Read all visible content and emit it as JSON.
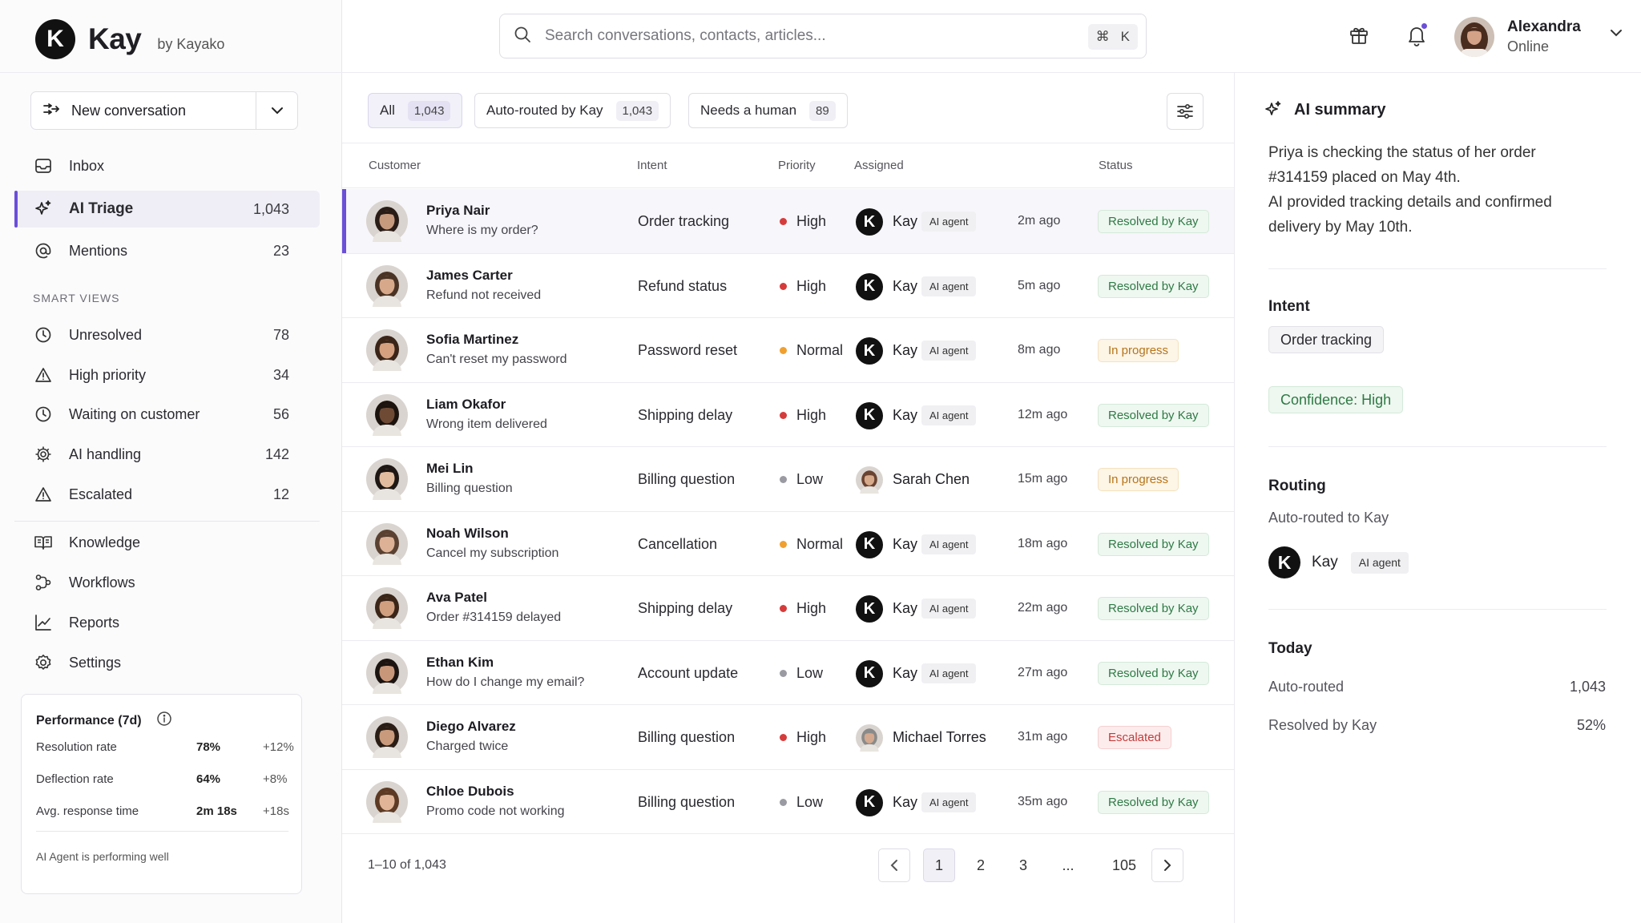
{
  "brand": {
    "logo_letter": "K",
    "name": "Kay",
    "by": "by Kayako"
  },
  "search": {
    "placeholder": "Search conversations, contacts, articles...",
    "shortcut_mod": "⌘",
    "shortcut_key": "K"
  },
  "user": {
    "name": "Alexandra",
    "status": "Online"
  },
  "sidebar": {
    "new_conversation": "New conversation",
    "primary": [
      {
        "label": "Inbox",
        "count": "",
        "icon": "inbox-icon"
      },
      {
        "label": "AI Triage",
        "count": "1,043",
        "icon": "sparkle-icon",
        "active": true
      },
      {
        "label": "Mentions",
        "count": "23",
        "icon": "at-icon"
      }
    ],
    "smart_views_label": "SMART VIEWS",
    "smart_views": [
      {
        "label": "Unresolved",
        "count": "78",
        "icon": "clock-icon"
      },
      {
        "label": "High priority",
        "count": "34",
        "icon": "warning-icon"
      },
      {
        "label": "Waiting on customer",
        "count": "56",
        "icon": "clock-icon"
      },
      {
        "label": "AI handling",
        "count": "142",
        "icon": "gear-icon"
      },
      {
        "label": "Escalated",
        "count": "12",
        "icon": "warning-icon"
      }
    ],
    "tools": [
      {
        "label": "Knowledge",
        "icon": "book-icon"
      },
      {
        "label": "Workflows",
        "icon": "workflow-icon"
      },
      {
        "label": "Reports",
        "icon": "chart-icon"
      },
      {
        "label": "Settings",
        "icon": "settings-icon"
      }
    ],
    "performance": {
      "title": "Performance (7d)",
      "rows": [
        {
          "label": "Resolution rate",
          "value": "78%",
          "delta": "+12%"
        },
        {
          "label": "Deflection rate",
          "value": "64%",
          "delta": "+8%"
        },
        {
          "label": "Avg. response time",
          "value": "2m 18s",
          "delta": "+18s"
        }
      ],
      "note": "AI Agent is performing well"
    }
  },
  "filters": [
    {
      "label": "All",
      "count": "1,043",
      "active": true
    },
    {
      "label": "Auto-routed by Kay",
      "count": "1,043"
    },
    {
      "label": "Needs a human",
      "count": "89"
    }
  ],
  "table": {
    "columns": {
      "customer": "Customer",
      "intent": "Intent",
      "priority": "Priority",
      "assigned": "Assigned",
      "status": "Status"
    },
    "rows": [
      {
        "name": "Priya Nair",
        "sub": "Where is my order?",
        "intent": "Order tracking",
        "priority": "High",
        "assignee": "Kay",
        "ai": true,
        "time": "2m ago",
        "status": "Resolved by Kay",
        "status_type": "resolved",
        "selected": true,
        "skin": "#c79a7e",
        "hair": "#2a1c16"
      },
      {
        "name": "James Carter",
        "sub": "Refund not received",
        "intent": "Refund status",
        "priority": "High",
        "assignee": "Kay",
        "ai": true,
        "time": "5m ago",
        "status": "Resolved by Kay",
        "status_type": "resolved",
        "skin": "#d7a98a",
        "hair": "#4a3324"
      },
      {
        "name": "Sofia Martinez",
        "sub": "Can't reset my password",
        "intent": "Password reset",
        "priority": "Normal",
        "assignee": "Kay",
        "ai": true,
        "time": "8m ago",
        "status": "In progress",
        "status_type": "progress",
        "skin": "#d4a07f",
        "hair": "#3b2418"
      },
      {
        "name": "Liam Okafor",
        "sub": "Wrong item delivered",
        "intent": "Shipping delay",
        "priority": "High",
        "assignee": "Kay",
        "ai": true,
        "time": "12m ago",
        "status": "Resolved by Kay",
        "status_type": "resolved",
        "skin": "#6e4a35",
        "hair": "#1c130e"
      },
      {
        "name": "Mei Lin",
        "sub": "Billing question",
        "intent": "Billing question",
        "priority": "Low",
        "assignee": "Sarah Chen",
        "ai": false,
        "time": "15m ago",
        "status": "In progress",
        "status_type": "progress",
        "skin": "#e2bc9e",
        "hair": "#1e1714",
        "assignee_skin": "#d7aa8c",
        "assignee_hair": "#6a4331"
      },
      {
        "name": "Noah Wilson",
        "sub": "Cancel my subscription",
        "intent": "Cancellation",
        "priority": "Normal",
        "assignee": "Kay",
        "ai": true,
        "time": "18m ago",
        "status": "Resolved by Kay",
        "status_type": "resolved",
        "skin": "#dcb196",
        "hair": "#5a4132"
      },
      {
        "name": "Ava Patel",
        "sub": "Order #314159 delayed",
        "intent": "Shipping delay",
        "priority": "High",
        "assignee": "Kay",
        "ai": true,
        "time": "22m ago",
        "status": "Resolved by Kay",
        "status_type": "resolved",
        "skin": "#cf9f80",
        "hair": "#3a2518"
      },
      {
        "name": "Ethan Kim",
        "sub": "How do I change my email?",
        "intent": "Account update",
        "priority": "Low",
        "assignee": "Kay",
        "ai": true,
        "time": "27m ago",
        "status": "Resolved by Kay",
        "status_type": "resolved",
        "skin": "#c8977a",
        "hair": "#1b1411"
      },
      {
        "name": "Diego Alvarez",
        "sub": "Charged twice",
        "intent": "Billing question",
        "priority": "High",
        "assignee": "Michael Torres",
        "ai": false,
        "time": "31m ago",
        "status": "Escalated",
        "status_type": "escalated",
        "skin": "#c99b7c",
        "hair": "#2a1d15",
        "assignee_skin": "#d3a990",
        "assignee_hair": "#8a8a8a"
      },
      {
        "name": "Chloe Dubois",
        "sub": "Promo code not working",
        "intent": "Billing question",
        "priority": "Low",
        "assignee": "Kay",
        "ai": true,
        "time": "35m ago",
        "status": "Resolved by Kay",
        "status_type": "resolved",
        "skin": "#e0b597",
        "hair": "#5c3a24"
      }
    ],
    "ai_tag": "AI agent"
  },
  "pagination": {
    "info": "1–10 of 1,043",
    "pages": [
      "1",
      "2",
      "3",
      "...",
      "105"
    ],
    "current": "1"
  },
  "summary_panel": {
    "title": "AI summary",
    "text_lines": [
      "Priya is checking the status of her order",
      "#314159 placed on May 4th.",
      "AI provided tracking details and confirmed",
      "delivery by May 10th."
    ],
    "intent_heading": "Intent",
    "intent_value": "Order tracking",
    "confidence": "Confidence: High",
    "routing_heading": "Routing",
    "routing_text": "Auto-routed to Kay",
    "routing_agent": "Kay",
    "routing_tag": "AI agent",
    "today_heading": "Today",
    "today": [
      {
        "label": "Auto-routed",
        "value": "1,043"
      },
      {
        "label": "Resolved by Kay",
        "value": "52%"
      }
    ]
  },
  "colors": {
    "accent": "#6b4fd8",
    "high": "#d63b3b",
    "normal": "#f0a030",
    "low": "#9a9aa2"
  }
}
